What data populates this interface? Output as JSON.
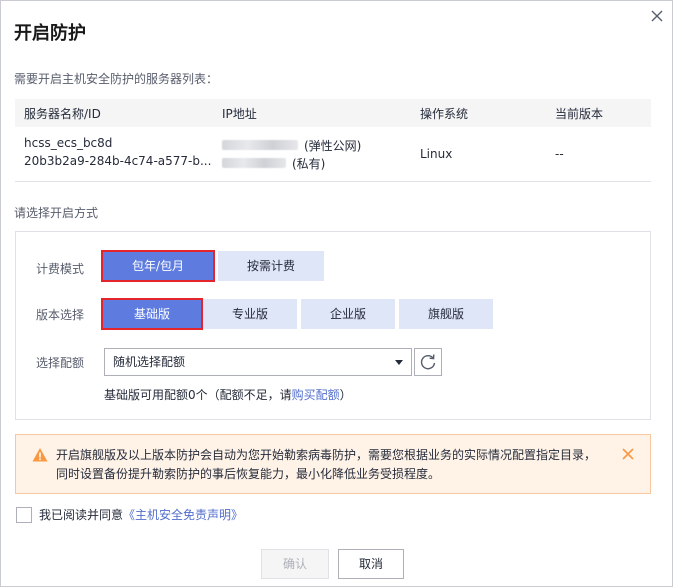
{
  "dialog": {
    "title": "开启防护"
  },
  "server_list": {
    "label": "需要开启主机安全防护的服务器列表：",
    "columns": [
      "服务器名称/ID",
      "IP地址",
      "操作系统",
      "当前版本"
    ],
    "rows": [
      {
        "name": "hcss_ecs_bc8d",
        "id": "20b3b2a9-284b-4c74-a577-b...",
        "ip_public_tag": "(弹性公网)",
        "ip_private_tag": "(私有)",
        "os": "Linux",
        "version": "--"
      }
    ]
  },
  "mode_section": {
    "label": "请选择开启方式",
    "billing": {
      "label": "计费模式",
      "options": [
        "包年/包月",
        "按需计费"
      ],
      "selected": "包年/包月"
    },
    "edition": {
      "label": "版本选择",
      "options": [
        "基础版",
        "专业版",
        "企业版",
        "旗舰版"
      ],
      "selected": "基础版"
    },
    "quota": {
      "label": "选择配额",
      "value": "随机选择配额",
      "note_prefix": "基础版可用配额0个（配额不足，请",
      "note_link": "购买配额",
      "note_suffix": "）"
    }
  },
  "notice": {
    "line1": "开启旗舰版及以上版本防护会自动为您开始勒索病毒防护，需要您根据业务的实际情况配置指定目录，",
    "line2": "同时设置备份提升勒索防护的事后恢复能力，最小化降低业务受损程度。"
  },
  "agreement": {
    "prefix": "我已阅读并同意",
    "link": "《主机安全免责声明》"
  },
  "footer": {
    "confirm": "确认",
    "cancel": "取消"
  },
  "colors": {
    "accent": "#5e7ce0",
    "segment_bg": "#dfe6f7",
    "highlight_box": "#e3242b",
    "warning": "#fa9841",
    "link": "#526ecc"
  },
  "icons": [
    "close-icon",
    "dropdown-caret-icon",
    "refresh-icon",
    "warning-icon",
    "notice-close-icon"
  ]
}
